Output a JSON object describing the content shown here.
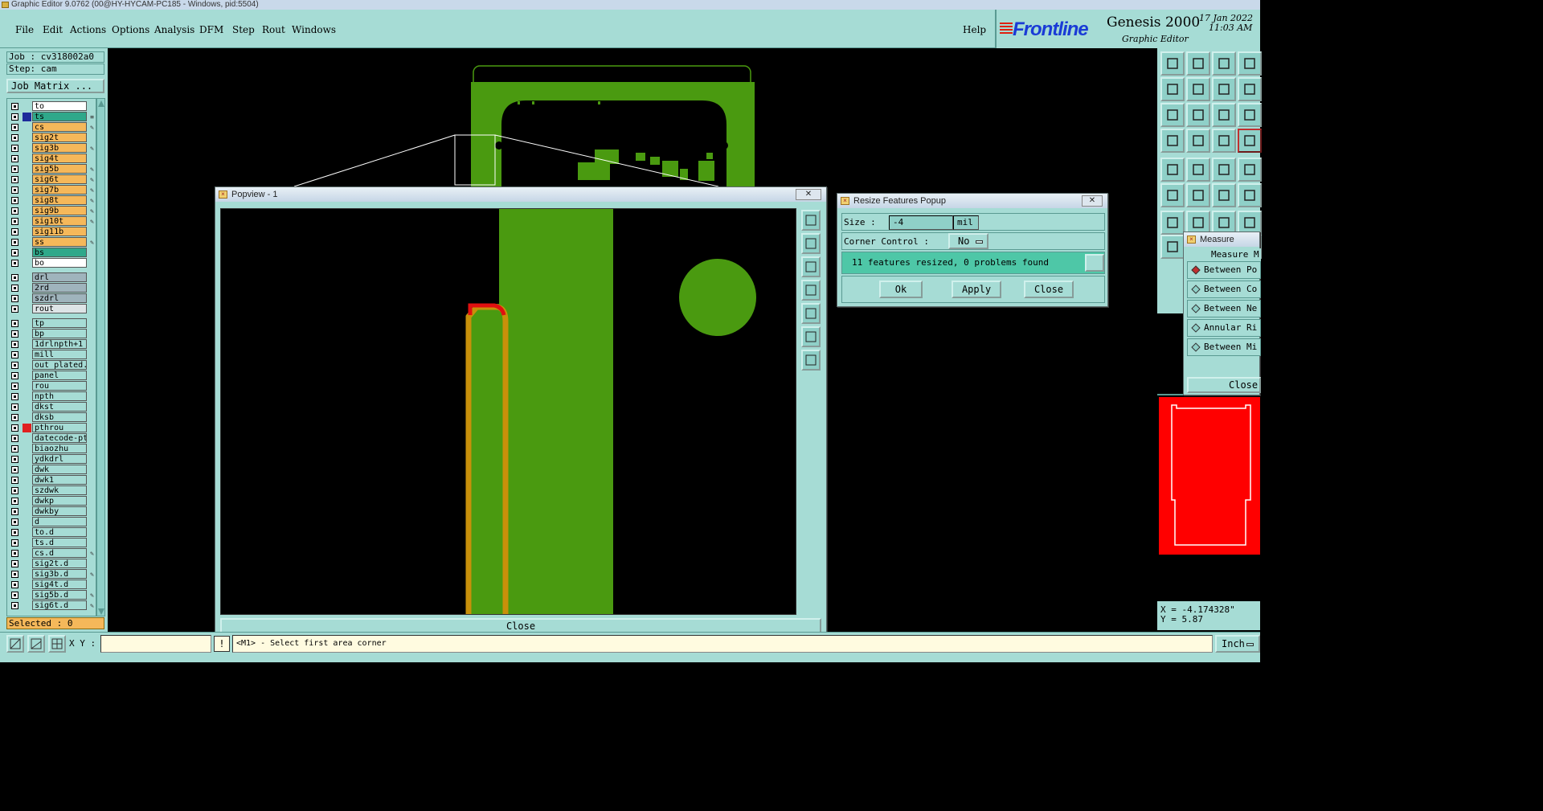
{
  "window_title": "Graphic Editor 9.0762 (00@HY-HYCAM-PC185 - Windows, pid:5504)",
  "menu": {
    "file": "File",
    "edit": "Edit",
    "actions": "Actions",
    "options": "Options",
    "analysis": "Analysis",
    "dfm": "DFM",
    "step": "Step",
    "rout": "Rout",
    "windows": "Windows",
    "help": "Help"
  },
  "brand": {
    "logo": "Frontline",
    "product": "Genesis 2000",
    "subtitle": "Graphic Editor",
    "date": "17 Jan 2022",
    "time": "11:03 AM"
  },
  "job": {
    "job_line": "Job : cv318002a0",
    "step_line": "Step: cam",
    "matrix_button": "Job Matrix ..."
  },
  "layers": [
    {
      "name": "to",
      "color": "#ffffff",
      "mark": ""
    },
    {
      "name": "ts",
      "color": "#2fa88a",
      "mark": "#1d2a9a",
      "pen": "≡"
    },
    {
      "name": "cs",
      "color": "#f5b85a",
      "mark": "",
      "pen": "✎"
    },
    {
      "name": "sig2t",
      "color": "#f5b85a",
      "mark": ""
    },
    {
      "name": "sig3b",
      "color": "#f5b85a",
      "mark": "",
      "pen": "✎"
    },
    {
      "name": "sig4t",
      "color": "#f5b85a",
      "mark": ""
    },
    {
      "name": "sig5b",
      "color": "#f5b85a",
      "mark": "",
      "pen": "✎"
    },
    {
      "name": "sig6t",
      "color": "#f5b85a",
      "mark": "",
      "pen": "✎"
    },
    {
      "name": "sig7b",
      "color": "#f5b85a",
      "mark": "",
      "pen": "✎"
    },
    {
      "name": "sig8t",
      "color": "#f5b85a",
      "mark": "",
      "pen": "✎"
    },
    {
      "name": "sig9b",
      "color": "#f5b85a",
      "mark": "",
      "pen": "✎"
    },
    {
      "name": "sig10t",
      "color": "#f5b85a",
      "mark": "",
      "pen": "✎"
    },
    {
      "name": "sig11b",
      "color": "#f5b85a",
      "mark": ""
    },
    {
      "name": "ss",
      "color": "#f5b85a",
      "mark": "",
      "pen": "✎"
    },
    {
      "name": "bs",
      "color": "#2fa88a",
      "mark": ""
    },
    {
      "name": "bo",
      "color": "#ffffff",
      "mark": ""
    },
    {
      "name": "drl",
      "color": "#9fb4bc",
      "mark": "",
      "gap": true
    },
    {
      "name": "2rd",
      "color": "#9fb4bc",
      "mark": ""
    },
    {
      "name": "szdrl",
      "color": "#9fb4bc",
      "mark": ""
    },
    {
      "name": "rout",
      "color": "#dde4e6",
      "mark": ""
    },
    {
      "name": "tp",
      "color": "#a6dcd5",
      "mark": "",
      "gap": true
    },
    {
      "name": "bp",
      "color": "#a6dcd5",
      "mark": ""
    },
    {
      "name": "1drlnpth+1",
      "color": "#a6dcd5",
      "mark": ""
    },
    {
      "name": "mill",
      "color": "#a6dcd5",
      "mark": ""
    },
    {
      "name": "out_plated.",
      "color": "#a6dcd5",
      "mark": ""
    },
    {
      "name": "panel",
      "color": "#a6dcd5",
      "mark": ""
    },
    {
      "name": "rou",
      "color": "#a6dcd5",
      "mark": ""
    },
    {
      "name": "npth",
      "color": "#a6dcd5",
      "mark": ""
    },
    {
      "name": "dkst",
      "color": "#a6dcd5",
      "mark": ""
    },
    {
      "name": "dksb",
      "color": "#a6dcd5",
      "mark": ""
    },
    {
      "name": "pthrou",
      "color": "#a6dcd5",
      "mark": "#e02020"
    },
    {
      "name": "datecode-pt",
      "color": "#a6dcd5",
      "mark": ""
    },
    {
      "name": "biaozhu",
      "color": "#a6dcd5",
      "mark": ""
    },
    {
      "name": "ydkdrl",
      "color": "#a6dcd5",
      "mark": ""
    },
    {
      "name": "dwk",
      "color": "#a6dcd5",
      "mark": ""
    },
    {
      "name": "dwk1",
      "color": "#a6dcd5",
      "mark": ""
    },
    {
      "name": "szdwk",
      "color": "#a6dcd5",
      "mark": ""
    },
    {
      "name": "dwkp",
      "color": "#a6dcd5",
      "mark": ""
    },
    {
      "name": "dwkby",
      "color": "#a6dcd5",
      "mark": ""
    },
    {
      "name": "d",
      "color": "#a6dcd5",
      "mark": ""
    },
    {
      "name": "to.d",
      "color": "#a6dcd5",
      "mark": ""
    },
    {
      "name": "ts.d",
      "color": "#a6dcd5",
      "mark": ""
    },
    {
      "name": "cs.d",
      "color": "#a6dcd5",
      "mark": "",
      "pen": "✎"
    },
    {
      "name": "sig2t.d",
      "color": "#a6dcd5",
      "mark": ""
    },
    {
      "name": "sig3b.d",
      "color": "#a6dcd5",
      "mark": "",
      "pen": "✎"
    },
    {
      "name": "sig4t.d",
      "color": "#a6dcd5",
      "mark": ""
    },
    {
      "name": "sig5b.d",
      "color": "#a6dcd5",
      "mark": "",
      "pen": "✎"
    },
    {
      "name": "sig6t.d",
      "color": "#a6dcd5",
      "mark": "",
      "pen": "✎"
    }
  ],
  "selected": "Selected : 0",
  "statusbar": {
    "xy_label": "X Y :",
    "xy_value": "",
    "message": "<M1> - Select first area corner",
    "unit": "Inch"
  },
  "popview": {
    "title": "Popview - 1",
    "close": "Close"
  },
  "resize_popup": {
    "title": "Resize Features Popup",
    "size_label": "Size :",
    "size_value": "-4",
    "size_unit": "mil",
    "corner_label": "Corner Control :",
    "corner_value": "No",
    "result": "11 features resized, 0 problems found",
    "ok": "Ok",
    "apply": "Apply",
    "close": "Close"
  },
  "measure_popup": {
    "title": "Measure Popup",
    "header": "Measure M",
    "options": [
      "Between Po",
      "Between Co",
      "Between Ne",
      "Annular Ri",
      "Between Mi"
    ],
    "selected_index": 0,
    "close": "Close"
  },
  "coords": {
    "x": "X = -4.174328\"",
    "y": "Y = 5.87"
  },
  "colors": {
    "copper_green": "#4a9a10",
    "panel_teal": "#a6dcd5",
    "highlight_orange": "#c8900a",
    "highlight_red": "#e01010",
    "minimap_red": "#ff0000"
  }
}
